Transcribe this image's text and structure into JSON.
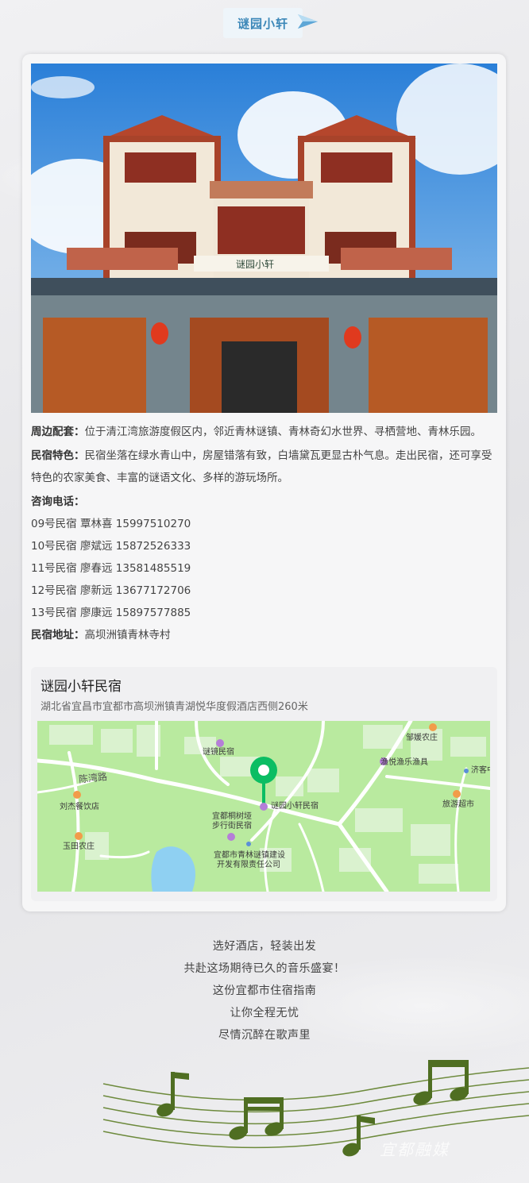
{
  "header": {
    "title": "谜园小轩"
  },
  "photo": {
    "sign_text": "谜园小轩"
  },
  "info": {
    "surroundings_label": "周边配套",
    "surroundings_text": "位于清江湾旅游度假区内，邻近青林谜镇、青林奇幻水世界、寻栖营地、青林乐园。",
    "features_label": "民宿特色",
    "features_text": "民宿坐落在绿水青山中，房屋错落有致，白墙黛瓦更显古朴气息。走出民宿，还可享受特色的农家美食、丰富的谜语文化、多样的游玩场所。",
    "phone_label": "咨询电话：",
    "phones": [
      "09号民宿 覃林喜 15997510270",
      "10号民宿  廖斌远 15872526333",
      "11号民宿  廖春远  13581485519",
      "12号民宿  廖新远  13677172706",
      "13号民宿  廖康远  15897577885"
    ],
    "address_label": "民宿地址",
    "address_text": "高坝洲镇青林寺村"
  },
  "map": {
    "name": "谜园小轩民宿",
    "address": "湖北省宜昌市宜都市高坝洲镇青湖悦华度假酒店西侧260米",
    "labels": {
      "mijing": "谜镜民宿",
      "road": "陈湾路",
      "liujie": "刘杰餐饮店",
      "yutian": "玉田农庄",
      "target": "谜园小轩民宿",
      "tongshu_1": "宜都桐树垭",
      "tongshu_2": "步行街民宿",
      "company_1": "宜都市青林谜镇建设",
      "company_2": "开发有限责任公司",
      "zouyuan": "邹媛农庄",
      "yuyue": "渔悦渔乐渔具",
      "jike": "济客中",
      "market": "旅游超市"
    }
  },
  "footer": {
    "lines": [
      "选好酒店，轻装出发",
      "共赴这场期待已久的音乐盛宴！",
      "这份宜都市住宿指南",
      "让你全程无忧",
      "尽情沉醉在歌声里"
    ],
    "watermark": "宜都融媒"
  },
  "colors": {
    "title_blue": "#3b87b8",
    "map_green": "#b9ea9f",
    "pin_green": "#0bbd63",
    "note_green": "#4f6e22"
  }
}
